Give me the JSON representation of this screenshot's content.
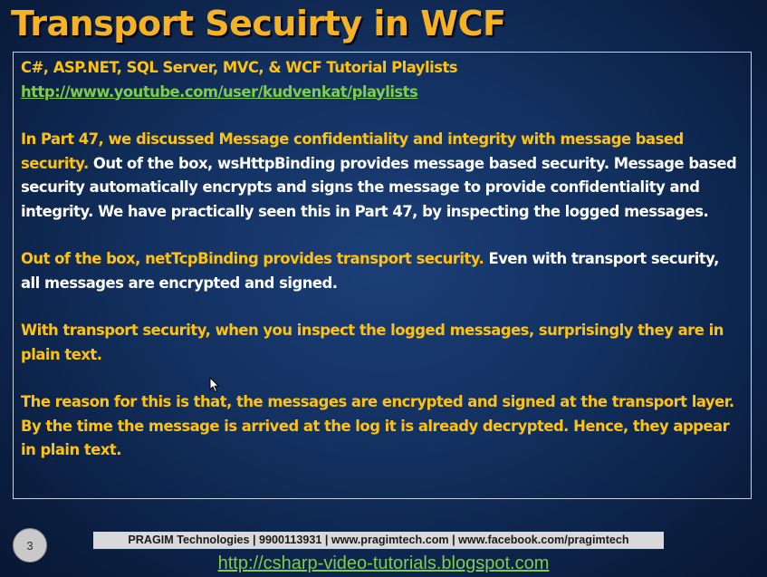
{
  "slide": {
    "title": "Transport Secuirty in WCF",
    "number": "3"
  },
  "content": {
    "playlist_heading": "C#, ASP.NET, SQL Server, MVC, & WCF Tutorial Playlists",
    "playlist_link": "http://www.youtube.com/user/kudvenkat/playlists",
    "para1_highlight": "In Part 47, we discussed Message confidentiality and integrity with message based security.",
    "para1_rest": " Out of the box, wsHttpBinding provides message based security. Message based security automatically encrypts and signs the message to provide confidentiality and integrity. We have practically seen this in Part 47, by inspecting the logged messages.",
    "para2_highlight": "Out of the box, netTcpBinding provides transport security.",
    "para2_rest": " Even with transport security, all messages are encrypted and signed.",
    "para3": "With transport security, when you inspect the logged messages, surprisingly they are in plain text.",
    "para4": "The reason for this is that, the messages are encrypted and signed at the transport layer. By the time the message is arrived at the log it is already decrypted. Hence, they appear in plain text."
  },
  "footer": {
    "company_info": "PRAGIM Technologies | 9900113931 | www.pragimtech.com | www.facebook.com/pragimtech",
    "blog_link": "http://csharp-video-tutorials.blogspot.com"
  },
  "colors": {
    "title": "#f5b324",
    "highlight_text": "#ffc20e",
    "body_text": "#ffffff",
    "link": "#7fce4a",
    "background": "#12305f"
  },
  "icons": {
    "cursor": "mouse-pointer-icon"
  }
}
